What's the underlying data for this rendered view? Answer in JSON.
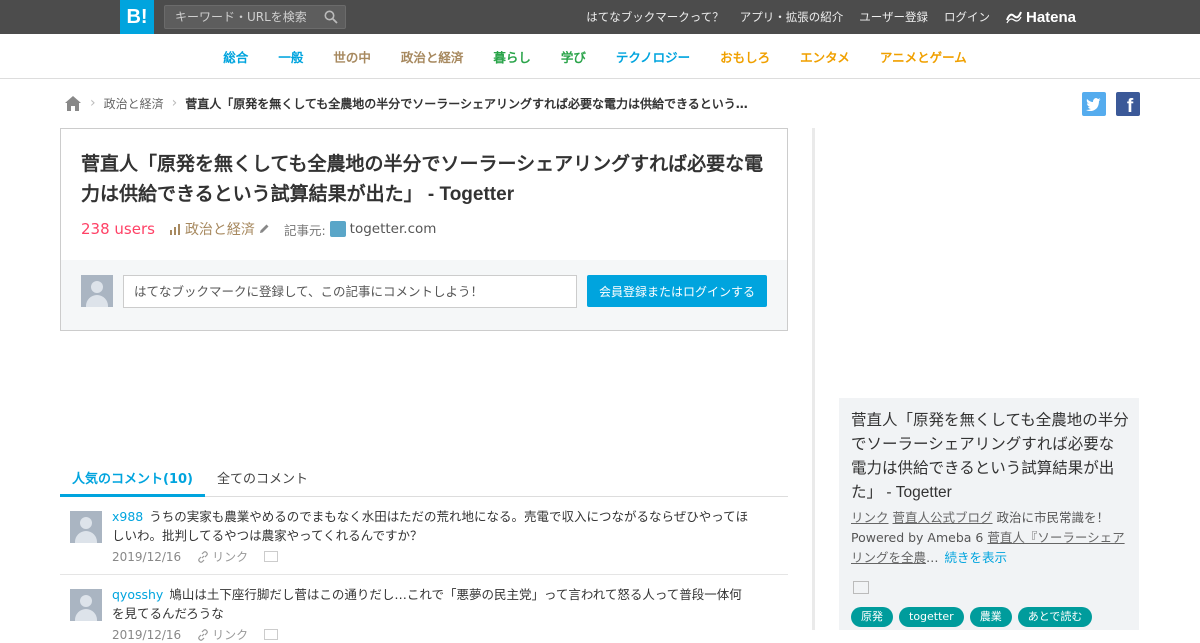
{
  "topbar": {
    "logo": "B!",
    "search_placeholder": "キーワード・URLを検索",
    "links": [
      "はてなブックマークって？",
      "アプリ・拡張の紹介",
      "ユーザー登録",
      "ログイン"
    ],
    "hatena": "Hatena",
    "brand_color": "#00a4de"
  },
  "categories": [
    {
      "label": "総合",
      "color": "#00a4de"
    },
    {
      "label": "一般",
      "color": "#00a4de"
    },
    {
      "label": "世の中",
      "color": "#a7895f"
    },
    {
      "label": "政治と経済",
      "color": "#a7895f"
    },
    {
      "label": "暮らし",
      "color": "#2aa44a"
    },
    {
      "label": "学び",
      "color": "#2aa44a"
    },
    {
      "label": "テクノロジー",
      "color": "#00a4de"
    },
    {
      "label": "おもしろ",
      "color": "#f0a000"
    },
    {
      "label": "エンタメ",
      "color": "#f0a000"
    },
    {
      "label": "アニメとゲーム",
      "color": "#f0a000"
    }
  ],
  "breadcrumb": {
    "category": "政治と経済",
    "current": "菅直人「原発を無くしても全農地の半分でソーラーシェアリングすれば必要な電力は供給できるという…"
  },
  "entry": {
    "title": "菅直人「原発を無くしても全農地の半分でソーラーシェアリングすれば必要な電力は供給できるという試算結果が出た」",
    "site": " - Togetter",
    "users": "238 users",
    "category": "政治と経済",
    "source_label": "記事元:",
    "source_domain": "togetter.com",
    "comment_placeholder": "はてなブックマークに登録して、この記事にコメントしよう！",
    "login_button": "会員登録またはログインする"
  },
  "comment_tabs": {
    "popular": "人気のコメント(10)",
    "all": "全てのコメント"
  },
  "comments": [
    {
      "user": "x988",
      "text": "うちの実家も農業やめるのでまもなく水田はただの荒れ地になる。売電で収入につながるならぜひやってほしいわ。批判してるやつは農家やってくれるんですか？",
      "date": "2019/12/16",
      "link_label": "リンク"
    },
    {
      "user": "qyosshy",
      "text": "鳩山は土下座行脚だし菅はこの通りだし…これで「悪夢の民主党」って言われて怒る人って普段一体何を見てるんだろうな",
      "date": "2019/12/16",
      "link_label": "リンク"
    }
  ],
  "related": {
    "title": "菅直人「原発を無くしても全農地の半分でソーラーシェアリングすれば必要な電力は供給できるという試算結果が出た」",
    "site": " - Togetter",
    "desc_pre": "リンク",
    "desc_link1": "菅直人公式ブログ",
    "desc_mid": " 政治に市民常識を！ Powered by Ameba 6 ",
    "desc_link2": "菅直人『ソーラーシェアリングを全農",
    "desc_tail": "…",
    "more": "続きを表示",
    "tags": [
      "原発",
      "togetter",
      "農業",
      "あとで読む"
    ]
  }
}
